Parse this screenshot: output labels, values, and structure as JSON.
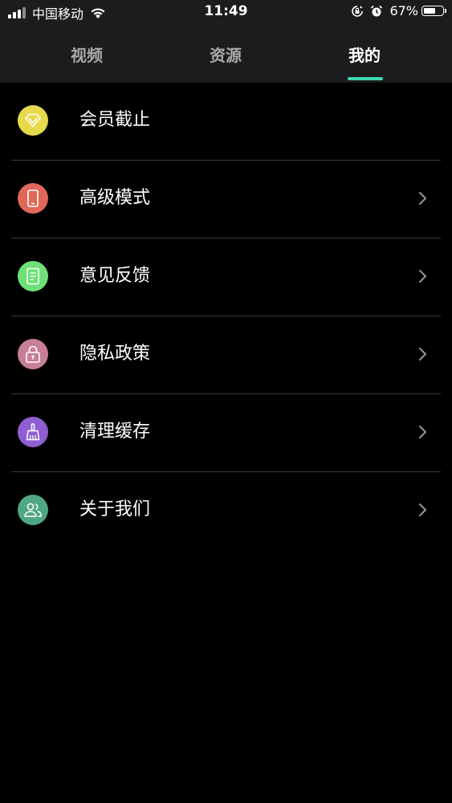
{
  "status_bar": {
    "carrier": "中国移动",
    "time": "11:49",
    "battery": "67%",
    "battery_level": 0.67,
    "icons": [
      "signal-icon",
      "wifi-icon",
      "orientation-lock-icon",
      "alarm-icon",
      "battery-icon"
    ]
  },
  "tabs": [
    {
      "label": "视频",
      "active": false
    },
    {
      "label": "资源",
      "active": false
    },
    {
      "label": "我的",
      "active": true
    }
  ],
  "colors": {
    "accent": "#3fd6b0",
    "background": "#000000",
    "header": "#1c1c1e"
  },
  "menu": {
    "items": [
      {
        "label": "会员截止",
        "icon": "diamond-icon",
        "icon_color": "#e6d94a",
        "has_chevron": false
      },
      {
        "label": "高级模式",
        "icon": "phone-icon",
        "icon_color": "#e0685a",
        "has_chevron": true
      },
      {
        "label": "意见反馈",
        "icon": "document-icon",
        "icon_color": "#6ee077",
        "has_chevron": true
      },
      {
        "label": "隐私政策",
        "icon": "lock-icon",
        "icon_color": "#c97e98",
        "has_chevron": true
      },
      {
        "label": "清理缓存",
        "icon": "broom-icon",
        "icon_color": "#8f5fd1",
        "has_chevron": true
      },
      {
        "label": "关于我们",
        "icon": "people-icon",
        "icon_color": "#4fa784",
        "has_chevron": true
      }
    ]
  }
}
